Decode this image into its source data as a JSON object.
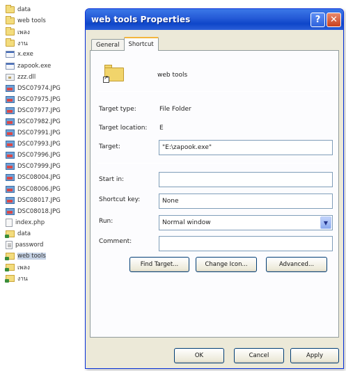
{
  "files": [
    {
      "name": "data",
      "icon": "folder-icon"
    },
    {
      "name": "web tools",
      "icon": "folder-icon"
    },
    {
      "name": "เพลง",
      "icon": "folder-icon"
    },
    {
      "name": "งาน",
      "icon": "folder-icon"
    },
    {
      "name": "x.exe",
      "icon": "exe-icon"
    },
    {
      "name": "zapook.exe",
      "icon": "exe-icon"
    },
    {
      "name": "zzz.dll",
      "icon": "dll-icon"
    },
    {
      "name": "DSC07974.JPG",
      "icon": "jpg-icon"
    },
    {
      "name": "DSC07975.JPG",
      "icon": "jpg-icon"
    },
    {
      "name": "DSC07977.JPG",
      "icon": "jpg-icon"
    },
    {
      "name": "DSC07982.JPG",
      "icon": "jpg-icon"
    },
    {
      "name": "DSC07991.JPG",
      "icon": "jpg-icon"
    },
    {
      "name": "DSC07993.JPG",
      "icon": "jpg-icon"
    },
    {
      "name": "DSC07996.JPG",
      "icon": "jpg-icon"
    },
    {
      "name": "DSC07999.JPG",
      "icon": "jpg-icon"
    },
    {
      "name": "DSC08004.JPG",
      "icon": "jpg-icon"
    },
    {
      "name": "DSC08006.JPG",
      "icon": "jpg-icon"
    },
    {
      "name": "DSC08017.JPG",
      "icon": "jpg-icon"
    },
    {
      "name": "DSC08018.JPG",
      "icon": "jpg-icon"
    },
    {
      "name": "index.php",
      "icon": "php-icon"
    },
    {
      "name": "data",
      "icon": "shortcut-folder-icon"
    },
    {
      "name": "password",
      "icon": "text-file-icon"
    },
    {
      "name": "web tools",
      "icon": "shortcut-folder-icon",
      "selected": true
    },
    {
      "name": "เพลง",
      "icon": "shortcut-folder-icon"
    },
    {
      "name": "งาน",
      "icon": "shortcut-folder-icon"
    }
  ],
  "dialog": {
    "title": "web tools Properties",
    "help_label": "?",
    "close_label": "✕",
    "tabs": [
      {
        "label": "General",
        "active": false
      },
      {
        "label": "Shortcut",
        "active": true
      }
    ],
    "name": "web tools",
    "target_type_label": "Target type:",
    "target_type_value": "File Folder",
    "target_location_label": "Target location:",
    "target_location_value": "E",
    "target_label": "Target:",
    "target_value": "\"E:\\zapook.exe\"",
    "start_in_label": "Start in:",
    "start_in_value": "",
    "shortcut_key_label": "Shortcut key:",
    "shortcut_key_value": "None",
    "run_label": "Run:",
    "run_value": "Normal window",
    "comment_label": "Comment:",
    "comment_value": "",
    "find_target_label": "Find Target...",
    "change_icon_label": "Change Icon...",
    "advanced_label": "Advanced...",
    "ok_label": "OK",
    "cancel_label": "Cancel",
    "apply_label": "Apply"
  },
  "colors": {
    "title_bar": "#2459d6",
    "dialog_bg": "#ece9d8",
    "active_tab_accent": "#f3b63d",
    "selected_row": "#c6d3e6"
  }
}
